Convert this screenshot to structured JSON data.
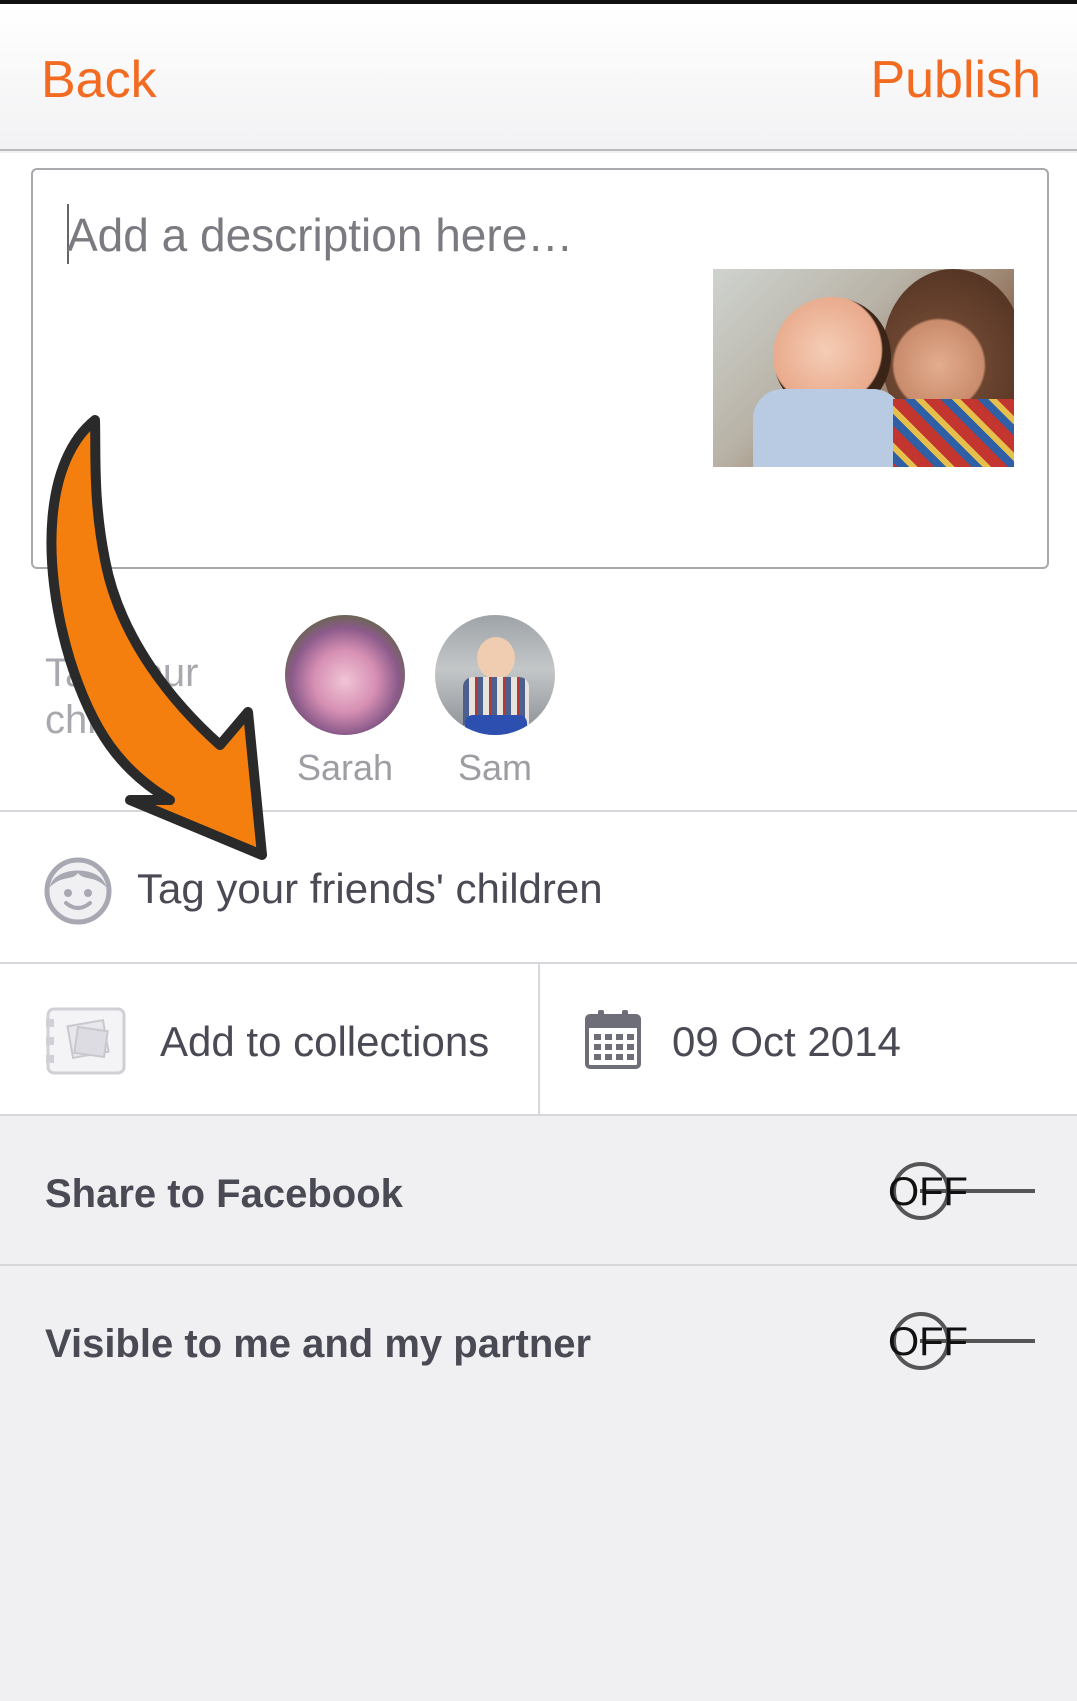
{
  "header": {
    "back_label": "Back",
    "publish_label": "Publish"
  },
  "description": {
    "placeholder": "Add a description here…"
  },
  "children": {
    "label": "Tag your children:",
    "items": [
      {
        "name": "Sarah"
      },
      {
        "name": "Sam"
      }
    ]
  },
  "friends": {
    "label": "Tag your friends' children",
    "icon": "face-icon"
  },
  "collections": {
    "label": "Add to collections",
    "icon": "album-icon"
  },
  "date": {
    "value": "09 Oct 2014",
    "icon": "calendar-icon"
  },
  "toggles": [
    {
      "label": "Share to Facebook",
      "state": "OFF"
    },
    {
      "label": "Visible to me and my partner",
      "state": "OFF"
    }
  ],
  "colors": {
    "accent": "#f26b21",
    "arrow": "#f57f0e"
  }
}
